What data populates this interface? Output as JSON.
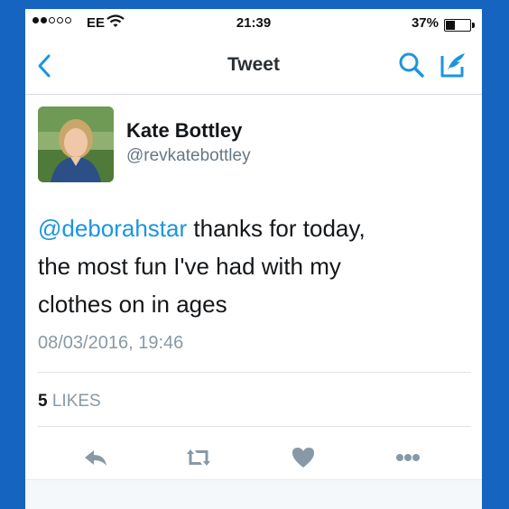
{
  "status_bar": {
    "signal_dots_filled": 2,
    "signal_dots_total": 5,
    "carrier": "EE",
    "time": "21:39",
    "battery": "37%",
    "battery_level": 0.37
  },
  "nav": {
    "title": "Tweet",
    "back_icon": "chevron-left-icon",
    "search_icon": "search-icon",
    "compose_icon": "compose-icon"
  },
  "tweet": {
    "author_name": "Kate Bottley",
    "author_handle": "@revkatebottley",
    "mention": "@deborahstar",
    "text_line1_rest": " thanks for today,",
    "text_line2": "the most fun I've had with my",
    "text_line3": "clothes on in ages",
    "timestamp": "08/03/2016, 19:46",
    "likes_count": "5",
    "likes_label": "LIKES"
  },
  "actions": [
    "reply-icon",
    "retweet-icon",
    "heart-icon",
    "more-icon"
  ],
  "colors": {
    "link": "#1b95e0",
    "icon_blue": "#1b95e0",
    "action_grey": "#8899a6",
    "frame_blue": "#1565c0"
  }
}
